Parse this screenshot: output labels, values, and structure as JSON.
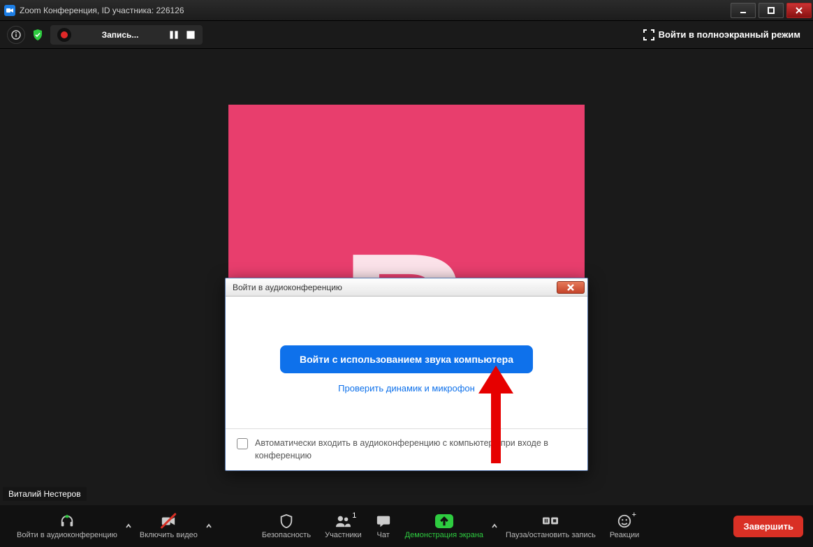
{
  "titlebar": {
    "title": "Zoom Конференция, ID участника: 226126"
  },
  "toolbar": {
    "recording_label": "Запись...",
    "fullscreen_label": "Войти в полноэкранный режим"
  },
  "video": {
    "user_name": "Виталий Нестеров",
    "avatar_letter": "В"
  },
  "modal": {
    "title": "Войти в аудиоконференцию",
    "primary_button": "Войти с использованием звука компьютера",
    "test_link": "Проверить динамик и микрофон",
    "auto_join_label": "Автоматически входить в аудиоконференцию с компьютера при входе в конференцию"
  },
  "bottom": {
    "audio": "Войти в аудиоконференцию",
    "video_btn": "Включить видео",
    "security": "Безопасность",
    "participants": "Участники",
    "participants_count": "1",
    "chat": "Чат",
    "share": "Демонстрация экрана",
    "record": "Пауза/остановить запись",
    "reactions": "Реакции",
    "end": "Завершить"
  }
}
